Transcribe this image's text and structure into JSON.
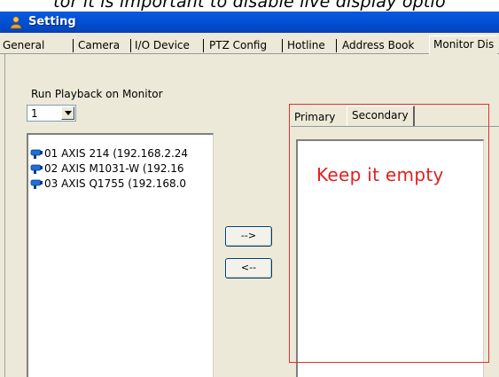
{
  "caption": "tor it is important to disable live display optio",
  "window": {
    "title": "Setting",
    "tabs": [
      "General",
      "Camera",
      "I/O Device",
      "PTZ Config",
      "Hotline",
      "Address Book",
      "Monitor Dis"
    ]
  },
  "left_panel": {
    "label": "Run Playback on Monitor",
    "monitor_select_value": "1",
    "cameras": [
      "01 AXIS 214 (192.168.2.24",
      "02 AXIS M1031-W (192.16",
      "03 AXIS Q1755 (192.168.0"
    ]
  },
  "buttons": {
    "add": "-->",
    "remove": "<--"
  },
  "right_panel": {
    "tabs": [
      "Primary",
      "Secondary"
    ],
    "active_tab": "Secondary"
  },
  "annotation": "Keep it empty",
  "colors": {
    "titlebar": "#0353d8",
    "annotation_red": "#e02020",
    "window_bg": "#ece9d8"
  }
}
